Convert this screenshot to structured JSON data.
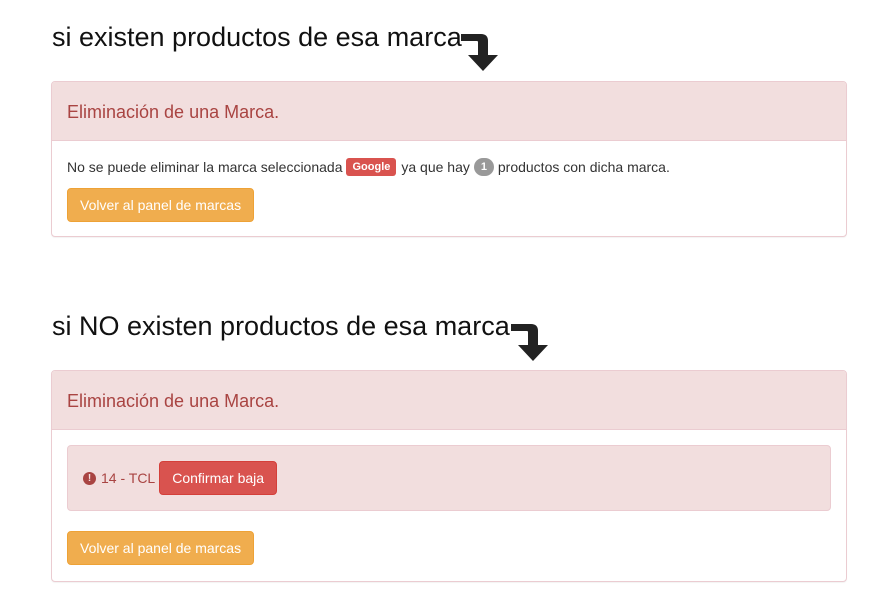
{
  "sections": [
    {
      "heading": "si  existen productos de esa marca",
      "arrow_icon": "arrow-turn-down-icon",
      "panel_title": "Eliminación de una Marca.",
      "message_before": "No se puede eliminar la marca seleccionada",
      "brand_label": "Google",
      "message_middle": "ya que hay",
      "product_count": "1",
      "message_after": "productos con dicha marca.",
      "back_button": "Volver al panel de marcas"
    },
    {
      "heading": "si  NO existen productos de esa marca",
      "arrow_icon": "arrow-turn-down-icon",
      "panel_title": "Eliminación de una Marca.",
      "alert_icon": "exclamation-circle-icon",
      "item_text": "14 - TCL",
      "confirm_button": "Confirmar baja",
      "back_button": "Volver al panel de marcas"
    }
  ],
  "colors": {
    "panel_heading_bg": "#f2dede",
    "panel_border": "#ebccd1",
    "panel_title_text": "#a94442",
    "warning_button": "#f0ad4e",
    "danger_button": "#d9534f",
    "badge": "#999999"
  }
}
